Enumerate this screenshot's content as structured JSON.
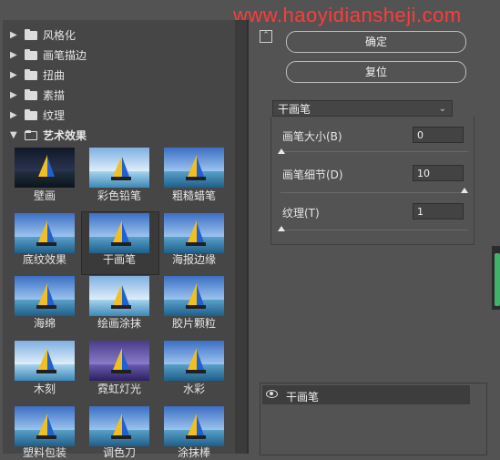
{
  "watermark": "www.haoyidiansheji.com",
  "categories": [
    {
      "label": "风格化"
    },
    {
      "label": "画笔描边"
    },
    {
      "label": "扭曲"
    },
    {
      "label": "素描"
    },
    {
      "label": "纹理"
    },
    {
      "label": "艺术效果"
    }
  ],
  "filters": [
    {
      "label": "壁画"
    },
    {
      "label": "彩色铅笔"
    },
    {
      "label": "粗糙蜡笔"
    },
    {
      "label": "底纹效果"
    },
    {
      "label": "干画笔"
    },
    {
      "label": "海报边缘"
    },
    {
      "label": "海绵"
    },
    {
      "label": "绘画涂抹"
    },
    {
      "label": "胶片颗粒"
    },
    {
      "label": "木刻"
    },
    {
      "label": "霓虹灯光"
    },
    {
      "label": "水彩"
    },
    {
      "label": "塑料包装"
    },
    {
      "label": "调色刀"
    },
    {
      "label": "涂抹棒"
    }
  ],
  "selected_filter": "干画笔",
  "buttons": {
    "ok": "确定",
    "reset": "复位"
  },
  "filter_select": {
    "value": "干画笔"
  },
  "params": [
    {
      "label": "画笔大小(B)",
      "value": "0",
      "slider_fraction": 0.0
    },
    {
      "label": "画笔细节(D)",
      "value": "10",
      "slider_fraction": 1.0
    },
    {
      "label": "纹理(T)",
      "value": "1",
      "slider_fraction": 0.0
    }
  ],
  "layer": {
    "label": "干画笔"
  },
  "icons": {
    "collapse": "chevron-up-icon",
    "eye": "eye-icon",
    "folder": "folder-icon"
  },
  "colors": {
    "panel": "#535353",
    "watermark": "#ff3b3b",
    "accent": "#3fb36a"
  }
}
